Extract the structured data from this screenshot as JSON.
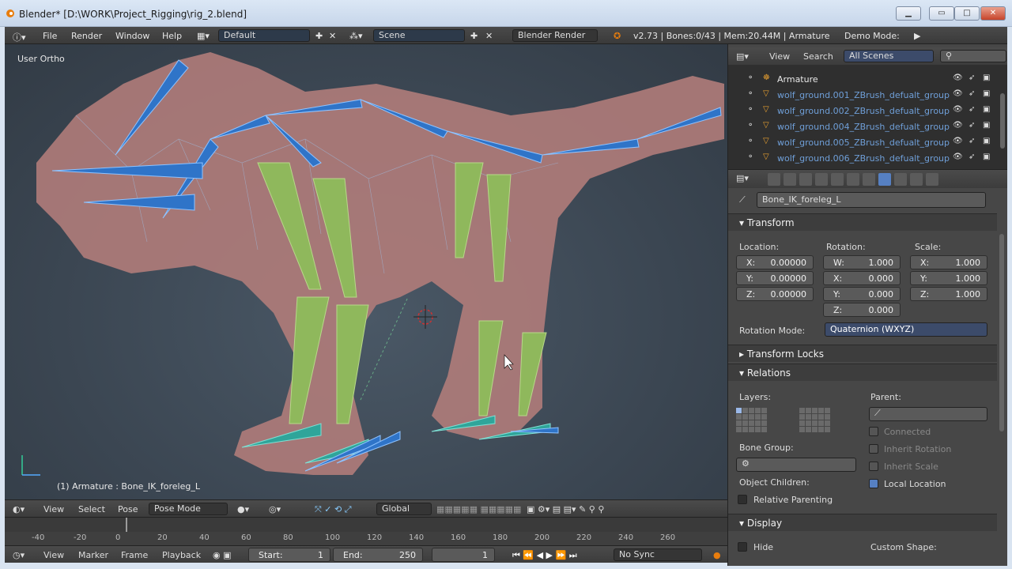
{
  "window": {
    "title": "Blender* [D:\\WORK\\Project_Rigging\\rig_2.blend]",
    "minimize_icon": "minimize-icon",
    "maximize_icon": "maximize-icon",
    "close_icon": "close-icon"
  },
  "menubar": {
    "items": [
      "File",
      "Render",
      "Window",
      "Help"
    ],
    "layout": "Default",
    "scene": "Scene",
    "engine": "Blender Render",
    "stats": "v2.73 | Bones:0/43 | Mem:20.44M | Armature",
    "demo_mode": "Demo Mode:"
  },
  "viewport": {
    "view_label": "User Ortho",
    "selection_label": "(1) Armature : Bone_IK_foreleg_L"
  },
  "viewport_header": {
    "view": "View",
    "select": "Select",
    "pose": "Pose",
    "mode": "Pose Mode",
    "orientation": "Global"
  },
  "timeline": {
    "ticks": [
      "-40",
      "-20",
      "0",
      "20",
      "40",
      "60",
      "80",
      "100",
      "120",
      "140",
      "160",
      "180",
      "200",
      "220",
      "240",
      "260"
    ],
    "current_frame_marker": "0"
  },
  "timeline_header": {
    "view": "View",
    "marker": "Marker",
    "frame": "Frame",
    "playback": "Playback",
    "start_label": "Start:",
    "start_value": "1",
    "end_label": "End:",
    "end_value": "250",
    "current_value": "1",
    "sync": "No Sync"
  },
  "outliner": {
    "view": "View",
    "search": "Search",
    "scope": "All Scenes",
    "rows": [
      {
        "label": "Armature",
        "type": "armature"
      },
      {
        "label": "wolf_ground.001_ZBrush_defualt_group.000",
        "type": "mesh"
      },
      {
        "label": "wolf_ground.002_ZBrush_defualt_group.001",
        "type": "mesh"
      },
      {
        "label": "wolf_ground.004_ZBrush_defualt_group.003",
        "type": "mesh"
      },
      {
        "label": "wolf_ground.005_ZBrush_defualt_group.004",
        "type": "mesh"
      },
      {
        "label": "wolf_ground.006_ZBrush_defualt_group.005",
        "type": "mesh"
      }
    ]
  },
  "properties": {
    "bone_name": "Bone_IK_foreleg_L",
    "transform": {
      "title": "Transform",
      "location_label": "Location:",
      "rotation_label": "Rotation:",
      "scale_label": "Scale:",
      "location": [
        {
          "k": "X:",
          "v": "0.00000"
        },
        {
          "k": "Y:",
          "v": "0.00000"
        },
        {
          "k": "Z:",
          "v": "0.00000"
        }
      ],
      "rotation": [
        {
          "k": "W:",
          "v": "1.000"
        },
        {
          "k": "X:",
          "v": "0.000"
        },
        {
          "k": "Y:",
          "v": "0.000"
        },
        {
          "k": "Z:",
          "v": "0.000"
        }
      ],
      "scale": [
        {
          "k": "X:",
          "v": "1.000"
        },
        {
          "k": "Y:",
          "v": "1.000"
        },
        {
          "k": "Z:",
          "v": "1.000"
        }
      ],
      "rotation_mode_label": "Rotation Mode:",
      "rotation_mode": "Quaternion (WXYZ)"
    },
    "transform_locks": "Transform Locks",
    "relations": {
      "title": "Relations",
      "layers_label": "Layers:",
      "parent_label": "Parent:",
      "connected": "Connected",
      "inherit_rotation": "Inherit Rotation",
      "inherit_scale": "Inherit Scale",
      "local_location": "Local Location",
      "bone_group_label": "Bone Group:",
      "object_children_label": "Object Children:",
      "relative_parenting": "Relative Parenting"
    },
    "display": {
      "title": "Display",
      "hide": "Hide",
      "custom_shape_label": "Custom Shape:"
    }
  },
  "colors": {
    "accent": "#5680c2",
    "bone_blue": "#2f74c8",
    "bone_green": "#8fb85c",
    "bone_teal": "#2fa59a",
    "mesh": "#c98787"
  }
}
